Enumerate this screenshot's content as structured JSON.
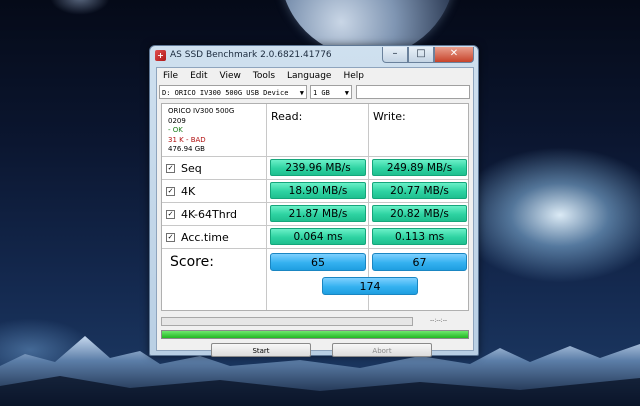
{
  "window": {
    "title": "AS SSD Benchmark 2.0.6821.41776"
  },
  "menu": [
    "File",
    "Edit",
    "View",
    "Tools",
    "Language",
    "Help"
  ],
  "toolbar": {
    "drive": "D: ORICO IV300 500G USB Device",
    "size": "1 GB",
    "extra_field": ""
  },
  "drive_info": {
    "name": "ORICO IV300 500G",
    "firmware": "0209",
    "driver_status": "- OK",
    "alignment": "31 K - BAD",
    "capacity": "476.94 GB"
  },
  "columns": {
    "read": "Read:",
    "write": "Write:"
  },
  "tests": [
    {
      "label": "Seq",
      "checked": true,
      "read": "239.96 MB/s",
      "write": "249.89 MB/s"
    },
    {
      "label": "4K",
      "checked": true,
      "read": "18.90 MB/s",
      "write": "20.77 MB/s"
    },
    {
      "label": "4K-64Thrd",
      "checked": true,
      "read": "21.87 MB/s",
      "write": "20.82 MB/s"
    },
    {
      "label": "Acc.time",
      "checked": true,
      "read": "0.064 ms",
      "write": "0.113 ms"
    }
  ],
  "score": {
    "label": "Score:",
    "read": "65",
    "write": "67",
    "total": "174"
  },
  "progress": {
    "time_text": "--:--:--",
    "main_fraction": 1.0,
    "top_fraction": 0
  },
  "buttons": {
    "start": "Start",
    "abort": "Abort"
  },
  "icons": {
    "app": "as-ssd-app-icon",
    "minimize": "minimize-icon",
    "maximize": "maximize-icon",
    "close": "close-icon",
    "checkbox": "checkbox-checked-icon",
    "dropdown": "chevron-down-icon"
  },
  "colors": {
    "value_bg": "#2ed3a2",
    "score_bg": "#34b1f0",
    "progress": "#22b822"
  }
}
